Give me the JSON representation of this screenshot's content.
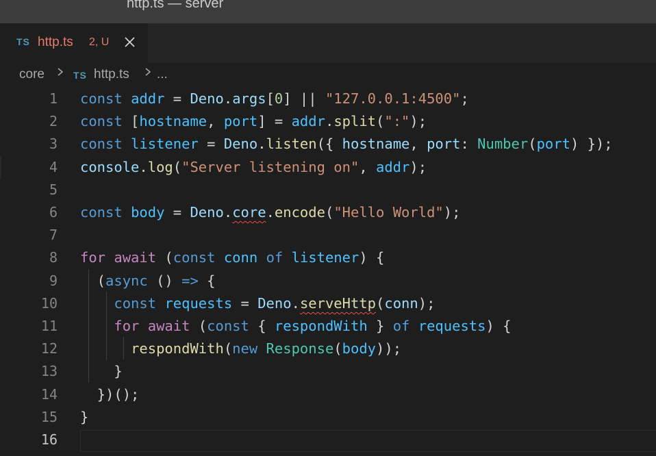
{
  "window": {
    "title": "http.ts — server"
  },
  "tab": {
    "icon": "TS",
    "name": "http.ts",
    "status": "2, U",
    "close_icon": "close-icon"
  },
  "breadcrumb": {
    "folder": "core",
    "file_icon": "TS",
    "file": "http.ts",
    "more": "..."
  },
  "editor": {
    "line_numbers": [
      "1",
      "2",
      "3",
      "4",
      "5",
      "6",
      "7",
      "8",
      "9",
      "10",
      "11",
      "12",
      "13",
      "14",
      "15",
      "16"
    ],
    "current_line": 16,
    "lines": [
      [
        [
          "k",
          "const"
        ],
        [
          "p",
          " "
        ],
        [
          "g",
          "addr"
        ],
        [
          "p",
          " = "
        ],
        [
          "v",
          "Deno"
        ],
        [
          "p",
          "."
        ],
        [
          "v",
          "args"
        ],
        [
          "p",
          "["
        ],
        [
          "n",
          "0"
        ],
        [
          "p",
          "] || "
        ],
        [
          "s",
          "\"127.0.0.1:4500\""
        ],
        [
          "p",
          ";"
        ]
      ],
      [
        [
          "k",
          "const"
        ],
        [
          "p",
          " ["
        ],
        [
          "g",
          "hostname"
        ],
        [
          "p",
          ", "
        ],
        [
          "g",
          "port"
        ],
        [
          "p",
          "] = "
        ],
        [
          "g",
          "addr"
        ],
        [
          "p",
          "."
        ],
        [
          "f",
          "split"
        ],
        [
          "p",
          "("
        ],
        [
          "s",
          "\":\""
        ],
        [
          "p",
          ");"
        ]
      ],
      [
        [
          "k",
          "const"
        ],
        [
          "p",
          " "
        ],
        [
          "g",
          "listener"
        ],
        [
          "p",
          " = "
        ],
        [
          "v",
          "Deno"
        ],
        [
          "p",
          "."
        ],
        [
          "f",
          "listen"
        ],
        [
          "p",
          "({ "
        ],
        [
          "v",
          "hostname"
        ],
        [
          "p",
          ", "
        ],
        [
          "v",
          "port"
        ],
        [
          "p",
          ": "
        ],
        [
          "t",
          "Number"
        ],
        [
          "p",
          "("
        ],
        [
          "g",
          "port"
        ],
        [
          "p",
          ") });"
        ]
      ],
      [
        [
          "v",
          "console"
        ],
        [
          "p",
          "."
        ],
        [
          "f",
          "log"
        ],
        [
          "p",
          "("
        ],
        [
          "s",
          "\"Server listening on\""
        ],
        [
          "p",
          ", "
        ],
        [
          "g",
          "addr"
        ],
        [
          "p",
          ");"
        ]
      ],
      [],
      [
        [
          "k",
          "const"
        ],
        [
          "p",
          " "
        ],
        [
          "g",
          "body"
        ],
        [
          "p",
          " = "
        ],
        [
          "v",
          "Deno"
        ],
        [
          "p",
          "."
        ],
        [
          "v",
          "core",
          "squiggle"
        ],
        [
          "p",
          "."
        ],
        [
          "f",
          "encode"
        ],
        [
          "p",
          "("
        ],
        [
          "s",
          "\"Hello World\""
        ],
        [
          "p",
          ");"
        ]
      ],
      [],
      [
        [
          "c",
          "for"
        ],
        [
          "p",
          " "
        ],
        [
          "c",
          "await"
        ],
        [
          "p",
          " ("
        ],
        [
          "k",
          "const"
        ],
        [
          "p",
          " "
        ],
        [
          "g",
          "conn"
        ],
        [
          "p",
          " "
        ],
        [
          "k",
          "of"
        ],
        [
          "p",
          " "
        ],
        [
          "g",
          "listener"
        ],
        [
          "p",
          ") {"
        ]
      ],
      [
        [
          "p",
          "  ("
        ],
        [
          "k",
          "async"
        ],
        [
          "p",
          " () "
        ],
        [
          "k",
          "=>"
        ],
        [
          "p",
          " {"
        ]
      ],
      [
        [
          "p",
          "    "
        ],
        [
          "k",
          "const"
        ],
        [
          "p",
          " "
        ],
        [
          "g",
          "requests"
        ],
        [
          "p",
          " = "
        ],
        [
          "v",
          "Deno"
        ],
        [
          "p",
          "."
        ],
        [
          "f",
          "serveHttp",
          "squiggle"
        ],
        [
          "p",
          "("
        ],
        [
          "v",
          "conn"
        ],
        [
          "p",
          ");"
        ]
      ],
      [
        [
          "p",
          "    "
        ],
        [
          "c",
          "for"
        ],
        [
          "p",
          " "
        ],
        [
          "c",
          "await"
        ],
        [
          "p",
          " ("
        ],
        [
          "k",
          "const"
        ],
        [
          "p",
          " { "
        ],
        [
          "g",
          "respondWith"
        ],
        [
          "p",
          " } "
        ],
        [
          "k",
          "of"
        ],
        [
          "p",
          " "
        ],
        [
          "g",
          "requests"
        ],
        [
          "p",
          ") {"
        ]
      ],
      [
        [
          "p",
          "      "
        ],
        [
          "f",
          "respondWith"
        ],
        [
          "p",
          "("
        ],
        [
          "k",
          "new"
        ],
        [
          "p",
          " "
        ],
        [
          "t",
          "Response"
        ],
        [
          "p",
          "("
        ],
        [
          "g",
          "body"
        ],
        [
          "p",
          "));"
        ]
      ],
      [
        [
          "p",
          "    }"
        ]
      ],
      [
        [
          "p",
          "  })();"
        ]
      ],
      [
        [
          "p",
          "}"
        ]
      ],
      []
    ]
  }
}
